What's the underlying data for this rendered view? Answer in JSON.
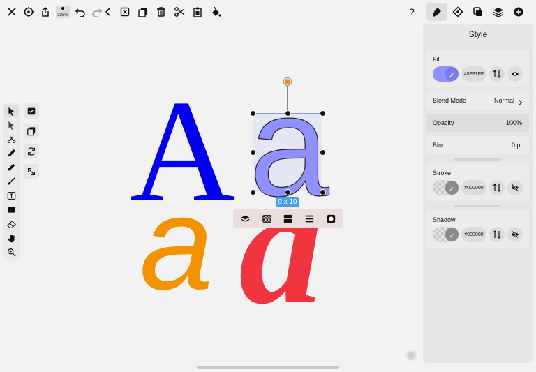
{
  "toolbar": {
    "zoom_label": "338%",
    "left_icons": [
      "close-icon",
      "settings-gear-icon",
      "share-icon",
      "undo-icon",
      "redo-icon",
      "chevron-left-icon"
    ],
    "edit_icons": [
      "delete-box-icon",
      "duplicate-icon",
      "trash-icon",
      "scissors-icon",
      "paste-icon",
      "paint-bucket-icon"
    ],
    "help_label": "?",
    "right_tabs": [
      "style-brush-icon",
      "shape-icon",
      "boolean-icon",
      "layers-icon",
      "add-icon"
    ]
  },
  "left_tools": [
    "select-arrow-icon",
    "direct-select-icon",
    "scissors-cut-icon",
    "pen-icon",
    "pencil-icon",
    "brush-icon",
    "text-icon",
    "rectangle-icon",
    "eraser-icon",
    "hand-icon",
    "zoom-icon"
  ],
  "side_tools": [
    "check-box-icon",
    "copy-icon",
    "rotate-icon",
    "resize-icon"
  ],
  "canvas": {
    "glyph_A": "A",
    "glyph_a": "a",
    "colors": {
      "blue": "#0000EE",
      "purple_fill": "#8F91FF",
      "orange": "#F39200",
      "red": "#F0353F"
    },
    "selection_size": "9 x 10"
  },
  "context_bar": [
    "layers-icon",
    "transparency-icon",
    "grid-icon",
    "align-icon",
    "mask-icon"
  ],
  "panel": {
    "title": "Style",
    "fill": {
      "label": "Fill",
      "hex": "#8F91FF",
      "color": "#8F91FF"
    },
    "blend_mode": {
      "label": "Blend Mode",
      "value": "Normal"
    },
    "opacity": {
      "label": "Opacity",
      "value": "100%"
    },
    "blur": {
      "label": "Blur",
      "value": "0 pt"
    },
    "stroke": {
      "label": "Stroke",
      "hex": "#000000"
    },
    "shadow": {
      "label": "Shadow",
      "hex": "#000000"
    }
  }
}
